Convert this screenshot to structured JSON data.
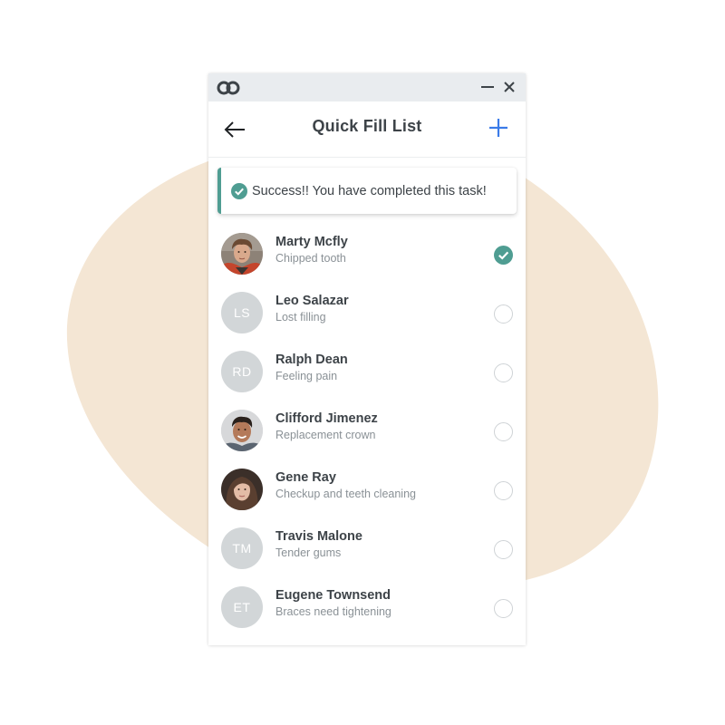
{
  "colors": {
    "accent_teal": "#4f9d92",
    "accent_blue": "#3b7be8",
    "blob": "#f5e6d3",
    "titlebar": "#e9ecef",
    "avatar_placeholder": "#d2d6d8",
    "text_primary": "#3d4348",
    "text_secondary": "#8a9196"
  },
  "window": {
    "logo_icon": "infinity-loop-logo",
    "controls": [
      {
        "name": "minimize",
        "icon": "minus-icon"
      },
      {
        "name": "close",
        "icon": "close-icon"
      }
    ]
  },
  "header": {
    "back_icon": "arrow-left-icon",
    "title": "Quick Fill List",
    "add_icon": "plus-icon"
  },
  "toast": {
    "icon": "check-circle-icon",
    "message": "Success!! You have completed this task!"
  },
  "patients": [
    {
      "name": "Marty Mcfly",
      "reason": "Chipped tooth",
      "avatar": "photo",
      "initials": "",
      "completed": true
    },
    {
      "name": "Leo Salazar",
      "reason": "Lost filling",
      "avatar": "initials",
      "initials": "LS",
      "completed": false
    },
    {
      "name": "Ralph Dean",
      "reason": "Feeling pain",
      "avatar": "initials",
      "initials": "RD",
      "completed": false
    },
    {
      "name": "Clifford Jimenez",
      "reason": "Replacement crown",
      "avatar": "photo",
      "initials": "",
      "completed": false
    },
    {
      "name": "Gene Ray",
      "reason": "Checkup and teeth cleaning",
      "avatar": "photo",
      "initials": "",
      "completed": false
    },
    {
      "name": "Travis Malone",
      "reason": "Tender gums",
      "avatar": "initials",
      "initials": "TM",
      "completed": false
    },
    {
      "name": "Eugene Townsend",
      "reason": "Braces need tightening",
      "avatar": "initials",
      "initials": "ET",
      "completed": false
    }
  ]
}
